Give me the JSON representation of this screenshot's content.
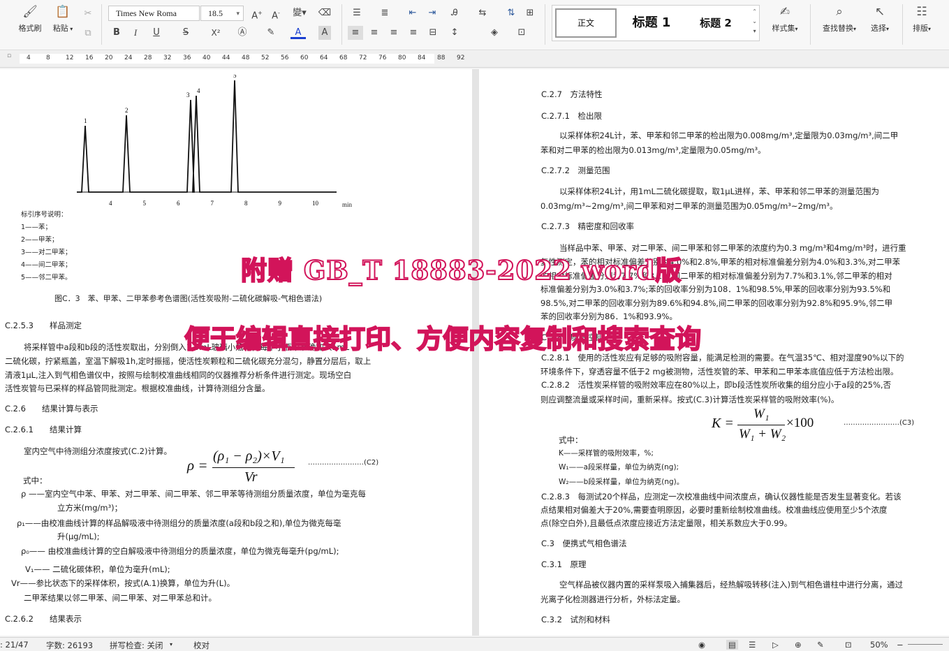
{
  "toolbar": {
    "format_painter": "格式刷",
    "paste": "粘贴",
    "font_name": "Times New Roma",
    "font_size": "18.5",
    "style_normal": "正文",
    "style_h1": "标题 1",
    "style_h2": "标题 2",
    "style_set": "样式集",
    "find_replace": "查找替换",
    "select": "选择",
    "arrange": "排版",
    "bold": "B",
    "italic": "I",
    "underline": "U",
    "strike": "S",
    "superscript": "X²",
    "font_color": "A",
    "font_size_up": "A⁺",
    "font_size_down": "A⁻",
    "phonetic": "wén"
  },
  "ruler": {
    "ticks": [
      "4",
      "8",
      "12",
      "16",
      "20",
      "24",
      "28",
      "32",
      "36",
      "40",
      "44",
      "48",
      "52",
      "56",
      "60",
      "64",
      "68",
      "72",
      "76",
      "80",
      "84",
      "88",
      "92"
    ]
  },
  "left_page": {
    "chart_peaks": [
      "1",
      "2",
      "3",
      "4",
      "5"
    ],
    "chart_xticks": [
      "4",
      "5",
      "6",
      "7",
      "8",
      "9",
      "10"
    ],
    "chart_unit": "min",
    "legend_title": "标引序号说明：",
    "legend": [
      "1——苯；",
      "2——甲苯；",
      "3——对二甲苯；",
      "4——间二甲苯；",
      "5——邻二甲苯。"
    ],
    "figure_caption": "图C．3　苯、甲苯、二甲苯参考色谱图(活性炭吸附-二硫化碳解吸-气相色谱法)",
    "s_c253": "C.2.5.3　　样品测定",
    "p_c253": [
      "将采样管中a段和b段的活性炭取出，分别倒入1.5mL玻璃小瓶中，每个小瓶中准确加入1mL",
      "二硫化碳，拧紧瓶盖，室温下解吸1h,定时振摇，使活性炭颗粒和二硫化碳充分混匀，静置分层后，取上",
      "清液1μL,注入到气相色谱仪中，按照与绘制校准曲线相同的仪器推荐分析条件进行测定。现场空白",
      "活性炭管与已采样的样品管同批测定。根据校准曲线，计算待测组分含量。"
    ],
    "s_c26": "C.2.6　　结果计算与表示",
    "s_c261": "C.2.6.1　　结果计算",
    "p_c261": "室内空气中待测组分浓度按式(C.2)计算。",
    "f_c2_num": "(ρ₁ − ρ₂)×V₁",
    "f_c2_den": "Vr",
    "f_c2_lhs": "ρ =",
    "f_c2_ref": "……………………(C2)",
    "where": "式中：",
    "d_rho": "ρ ——室内空气中苯、甲苯、对二甲苯、间二甲苯、邻二甲苯等待测组分质量浓度，单位为毫克每",
    "d_rho2": "立方米(mg/m³)；",
    "d_rho1": "ρ₁——由校准曲线计算的样品解吸液中待测组分的质量浓度(a段和b段之和),单位为微克每毫",
    "d_rho1b": "升(μg/mL);",
    "d_rho0": "ρ₀—— 由校准曲线计算的空白解吸液中待测组分的质量浓度，单位为微克每毫升(pg/mL);",
    "d_v1": "V₁—— 二硫化碳体积，单位为毫升(mL);",
    "d_vr": "Vr——参比状态下的采样体积，按式(A.1)换算，单位为升(L)。",
    "d_xylene": "二甲苯结果以邻二甲苯、间二甲苯、对二甲苯总和计。",
    "s_c262": "C.2.6.2　　结果表示"
  },
  "right_page": {
    "s_c27": "C.2.7　方法特性",
    "s_c271": "C.2.7.1　检出限",
    "p_c271": [
      "以采样体积24L计，苯、甲苯和邻二甲苯的检出限为0.008mg/m³,定量限为0.03mg/m³,间二甲",
      "苯和对二甲苯的检出限为0.013mg/m³,定量限为0.05mg/m³。"
    ],
    "s_c272": "C.2.7.2　测量范围",
    "p_c272": [
      "以采样体积24L计，用1mL二硫化碳提取，取1μL进样，苯、甲苯和邻二甲苯的测量范围为",
      "0.03mg/m³~2mg/m³,间二甲苯和对二甲苯的测量范围为0.05mg/m³~2mg/m³。"
    ],
    "s_c273": "C.2.7.3　精密度和回收率",
    "p_c273": [
      "当样品中苯、甲苯、对二甲苯、间二甲苯和邻二甲苯的浓度约为0.3 mg/m³和4mg/m³时，进行重",
      "复性测定，苯的相对标准偏差分别为4.0%和2.8%,甲苯的相对标准偏差分别为4.0%和3.3%,对二甲苯",
      "的相对标准偏差分别为7.7%和3.1%,间二甲苯的相对标准偏差分别为7.7%和3.1%,邻二甲苯的相对",
      "标准偏差分别为3.0%和3.7%;苯的回收率分别为108．1%和98.5%,甲苯的回收率分别为93.5%和",
      "98.5%,对二甲苯的回收率分别为89.6%和94.8%,间二甲苯的回收率分别为92.8%和95.9%,邻二甲",
      "苯的回收率分别为86．1%和93.9%。"
    ],
    "s_c28": "C.2.8　质量控制",
    "p_c281": [
      "C.2.8.1　使用的活性炭应有足够的吸附容量，能满足检测的需要。在气温35℃、相对湿度90%以下的",
      "环境条件下，穿透容量不低于2 mg被测物，活性炭管的苯、甲苯和二甲苯本底值应低于方法检出限。"
    ],
    "p_c282": [
      "C.2.8.2　活性炭采样管的吸附效率应在80%以上，即b段活性炭所收集的组分应小于a段的25%,否",
      "则应调整流量或采样时间，重新采样。按式(C.3)计算活性炭采样管的吸附效率(%)。"
    ],
    "f_c3_lhs": "K =",
    "f_c3_num": "W₁",
    "f_c3_den": "W₁ + W₂",
    "f_c3_mult": "×100",
    "f_c3_ref": "……………………(C3)",
    "where": "式中：",
    "d_k": "K——采样管的吸附效率，%;",
    "d_w1": "W₁——a段采样量，单位为纳克(ng);",
    "d_w2": "W₂——b段采样量，单位为纳克(ng)。",
    "p_c283": [
      "C.2.8.3　每测试20个样品，应测定一次校准曲线中间浓度点，确认仪器性能是否发生显著变化。若该",
      "点结果相对偏差大于20%,需要查明原因，必要时重新绘制校准曲线。校准曲线应使用至少5个浓度",
      "点(除空白外),且最低点浓度应接近方法定量限，相关系数应大于0.99。"
    ],
    "s_c3": "C.3　便携式气相色谱法",
    "s_c31": "C.3.1　原理",
    "p_c31": [
      "空气样品被仪器内置的采样泵吸入捕集器后，经热解吸转移(注入)到气相色谱柱中进行分离，通过",
      "光离子化检测器进行分析，外标法定量。"
    ],
    "s_c32": "C.3.2　试剂和材料"
  },
  "overlay": {
    "line1": "附赠 GB_T 18883-2022 word版",
    "line2": "便于编辑直接打印、方便内容复制和搜索查询"
  },
  "status": {
    "page": ": 21/47",
    "words": "字数: 26193",
    "spell": "拼写检查: 关闭",
    "proof": "校对",
    "zoom": "50%"
  },
  "colors": {
    "overlay_stroke": "#d2145a",
    "accent": "#2b579a"
  }
}
